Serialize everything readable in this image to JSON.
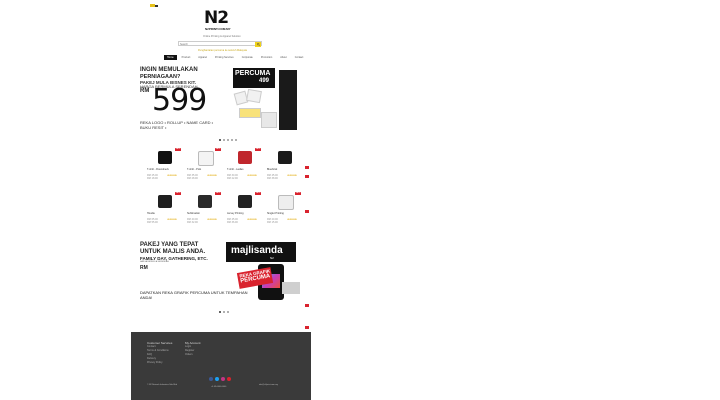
{
  "site": {
    "brand": "N2",
    "url": "N2PRINT.COM.MY",
    "tagline": "Online Printing & Apparel Solution",
    "search_placeholder": "Search",
    "promo": "Penghantaran percuma ke seluruh Malaysia"
  },
  "nav": {
    "items": [
      "Home",
      "Product",
      "Apparel",
      "Printing Services",
      "Corporate",
      "Promotion",
      "About",
      "Contact"
    ]
  },
  "hero": {
    "line1": "INGIN MEMULAKAN",
    "line2": "PERNIAGAAN?",
    "line3": "PAKEJ MULA BISNES KIT.",
    "line4": "HARGA BERMULA SERENDAH",
    "currency": "RM",
    "price": "599",
    "includes": "REKA LOGO • ROLLUP • NAME CARD • BUKU RESIT •",
    "badge_word": "PERCUMA",
    "badge_price": "499"
  },
  "products": [
    {
      "name": "T-shirt - Roundneck",
      "price_old": "RM 25.00",
      "price": "RM 18.90",
      "color": "#111111"
    },
    {
      "name": "T-shirt - Polo",
      "price_old": "RM 35.00",
      "price": "RM 28.90",
      "color": "#f4f4f4"
    },
    {
      "name": "T-shirt - Ladies",
      "price_old": "RM 30.00",
      "price": "RM 22.90",
      "color": "#c0272d"
    },
    {
      "name": "Bluebrisk",
      "price_old": "RM 45.00",
      "price": "RM 38.90",
      "color": "#1b1b1b"
    },
    {
      "name": "Hoodie",
      "price_old": "RM 65.00",
      "price": "RM 55.90",
      "color": "#1f1f1f"
    },
    {
      "name": "Sublimation",
      "price_old": "RM 40.00",
      "price": "RM 32.90",
      "color": "#2a2a2a"
    },
    {
      "name": "Jersey Printing",
      "price_old": "RM 45.00",
      "price": "RM 36.90",
      "color": "#222222"
    },
    {
      "name": "Singlet Printing",
      "price_old": "RM 20.00",
      "price": "RM 15.90",
      "color": "#eeeeee"
    }
  ],
  "product_badge": "SALE",
  "product_stars": "★★★★★",
  "banner2": {
    "line1": "PAKEJ YANG TEPAT",
    "line2": "UNTUK MAJLIS ANDA.",
    "line3": "FAMILY DAY, GATHERING, ETC.",
    "line4": "HARGA BERMULA SERENDAH",
    "currency": "RM",
    "footnote": "DAPATKAN REKA GRAFIK PERCUMA UNTUK TEMPAHAN ANDA!",
    "brand": "majlisanda",
    "brand_sub": "N2",
    "stamp_line1": "REKA GRAFIK",
    "stamp_line2": "PERCUMA"
  },
  "footer": {
    "col1_title": "Customer Services",
    "col1_links": [
      "Contact",
      "Terms & Conditions",
      "FAQ",
      "Delivery",
      "Privacy Policy"
    ],
    "col2_title": "My Account",
    "col2_links": [
      "Login",
      "Register",
      "Orders"
    ],
    "copyright": "© N2 Network Industries Sdn Bhd",
    "phone": "+6 03-0000 0000",
    "email": "info@n2print.com.my"
  },
  "colors": {
    "accent": "#f0d21c",
    "sale": "#d9232e",
    "footer_bg": "#3a3a3a",
    "social": [
      "#3b5998",
      "#1da1f2",
      "#c13584",
      "#d9232e"
    ]
  }
}
